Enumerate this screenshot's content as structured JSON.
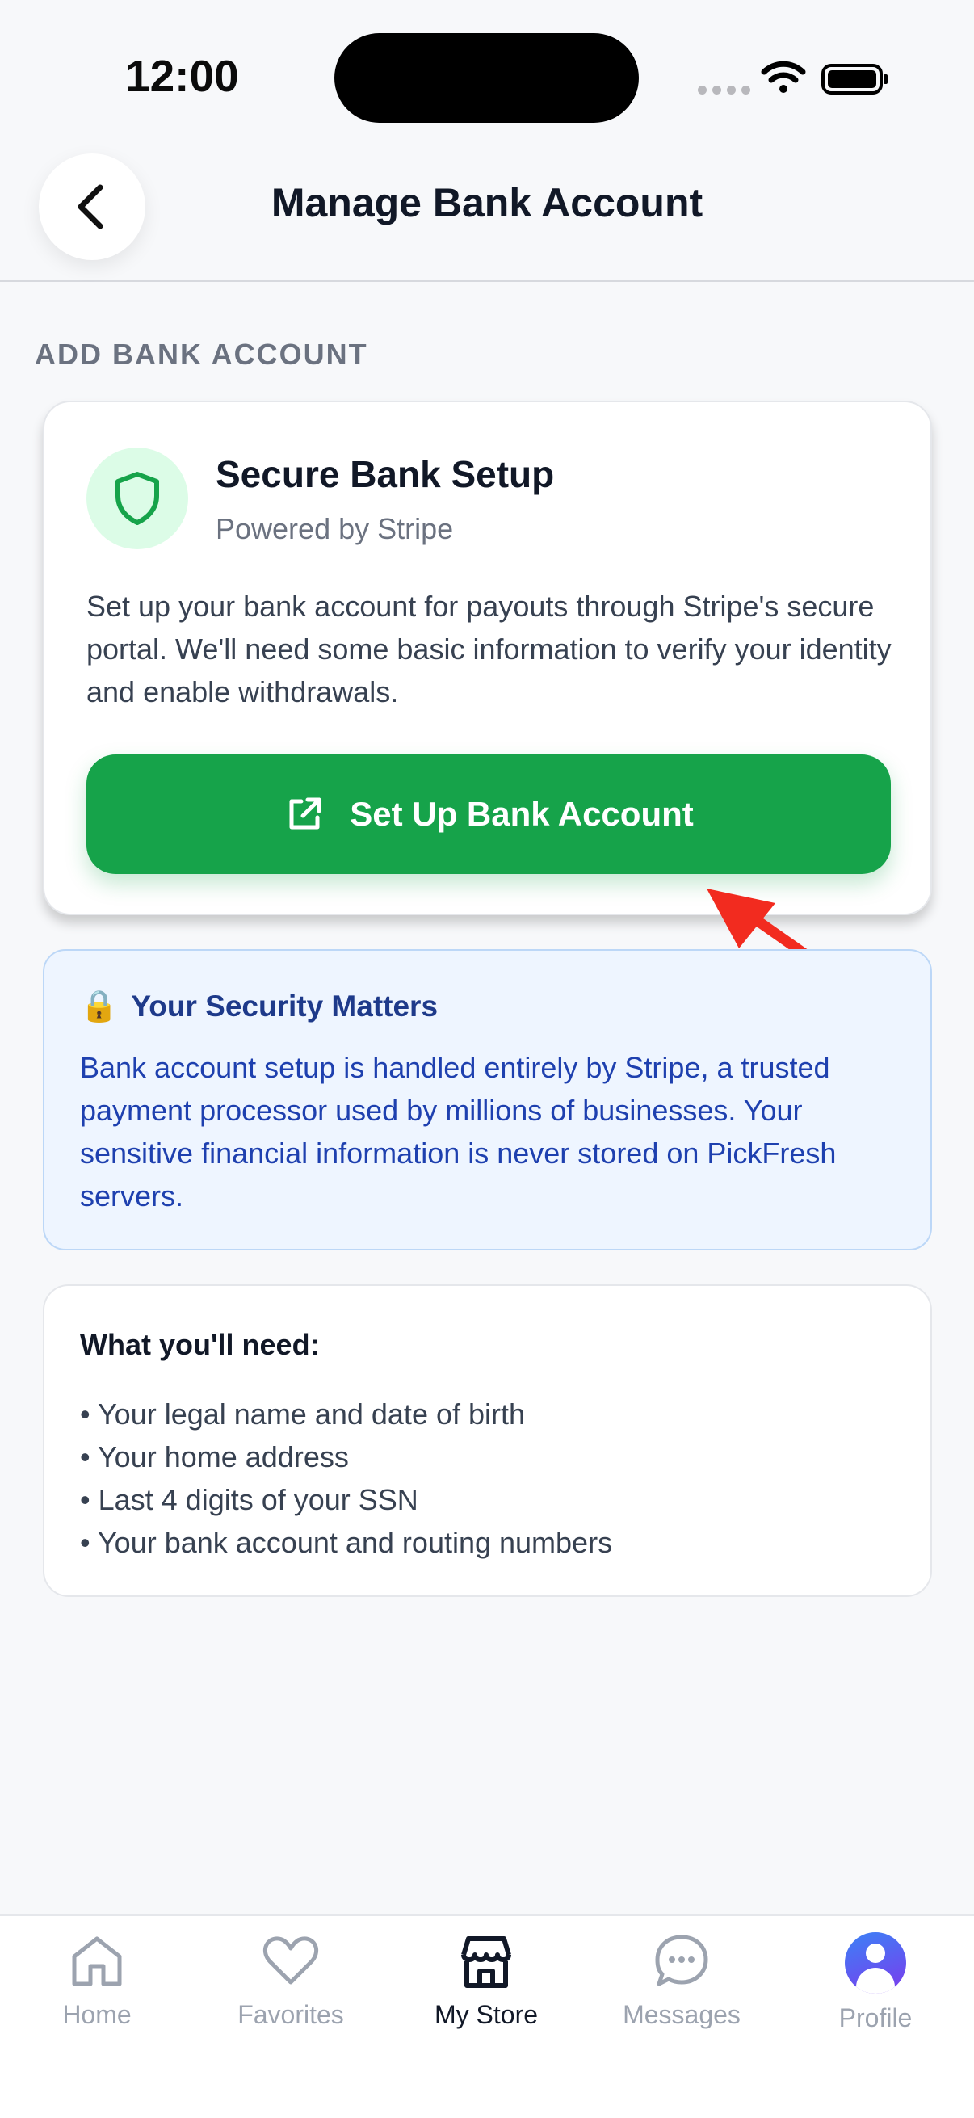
{
  "status_bar": {
    "time": "12:00"
  },
  "header": {
    "title": "Manage Bank Account",
    "back_icon": "chevron-left-icon"
  },
  "section": {
    "label": "ADD BANK ACCOUNT"
  },
  "setup_card": {
    "icon": "shield-icon",
    "title": "Secure Bank Setup",
    "subtitle": "Powered by Stripe",
    "description": "Set up your bank account for payouts through Stripe's secure portal. We'll need some basic information to verify your identity and enable withdrawals.",
    "button_label": "Set Up Bank Account",
    "button_icon": "external-link-icon"
  },
  "security_notice": {
    "icon": "🔒",
    "title": "Your Security Matters",
    "text": "Bank account setup is handled entirely by Stripe, a trusted payment processor used by millions of businesses. Your sensitive financial information is never stored on PickFresh servers."
  },
  "requirements": {
    "title": "What you'll need:",
    "items": [
      "Your legal name and date of birth",
      "Your home address",
      "Last 4 digits of your SSN",
      "Your bank account and routing numbers"
    ]
  },
  "tabs": [
    {
      "label": "Home",
      "icon": "home-icon",
      "active": false
    },
    {
      "label": "Favorites",
      "icon": "heart-icon",
      "active": false
    },
    {
      "label": "My Store",
      "icon": "store-icon",
      "active": true
    },
    {
      "label": "Messages",
      "icon": "chat-icon",
      "active": false
    },
    {
      "label": "Profile",
      "icon": "avatar-icon",
      "active": false
    }
  ],
  "colors": {
    "primary_green": "#16a34a",
    "notice_blue": "#1e40af",
    "notice_background": "#eef5ff",
    "annotation_red": "#f22b1f"
  }
}
